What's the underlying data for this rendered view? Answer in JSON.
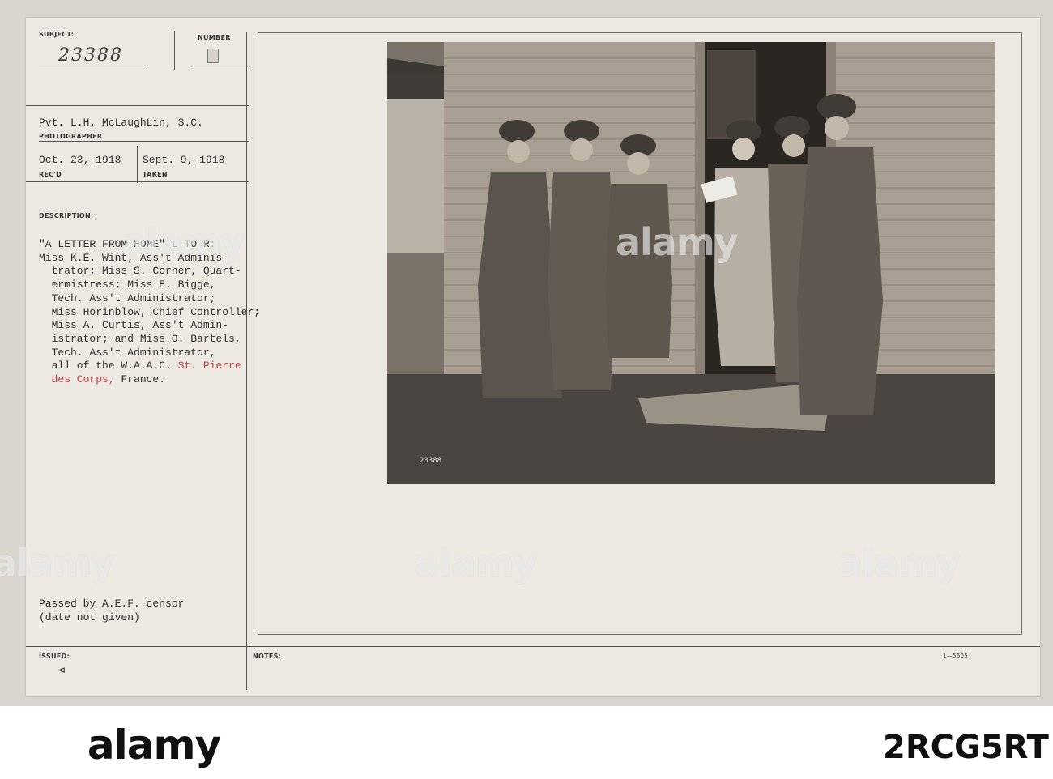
{
  "card": {
    "subject_label": "SUBJECT:",
    "subject_number": "23388",
    "number_label": "NUMBER",
    "photographer": "Pvt. L.H. McLaughLin, S.C.",
    "photographer_label": "PHOTOGRAPHER",
    "received_date": "Oct. 23, 1918",
    "received_label": "REC'D",
    "taken_date": "Sept. 9, 1918",
    "taken_label": "TAKEN",
    "description_label": "DESCRIPTION:",
    "description_lines": [
      "\"A LETTER FROM HOME\" L TO R:",
      "Miss K.E. Wint, Ass't Adminis-",
      "  trator; Miss S. Corner, Quart-",
      "  ermistress; Miss E. Bigge,",
      "  Tech. Ass't Administrator;",
      "  Miss Horinblow, Chief Controller;",
      "  Miss A. Curtis, Ass't Admin-",
      "  istrator; and Miss O. Bartels,",
      "  Tech. Ass't Administrator,",
      "  all of the W.A.A.C."
    ],
    "place_line1": "St. Pierre",
    "place_line2_a": "  des Corps,",
    "place_line2_b": " France.",
    "censor_line1": "Passed by A.E.F. censor",
    "censor_line2": "(date not given)",
    "issued_label": "ISSUED:",
    "issued_mark": "⊲",
    "notes_label": "NOTES:",
    "form_number": "1—5605",
    "photo_caption": "23388"
  },
  "watermark": {
    "text": "alamy"
  },
  "footer": {
    "logo": "alamy",
    "stock_id": "2RCG5RT"
  },
  "colors": {
    "card": "#ece9e2",
    "ink": "#2f2f2f",
    "red_ink": "#c23b3b",
    "photo_tone": "#6a6259"
  }
}
